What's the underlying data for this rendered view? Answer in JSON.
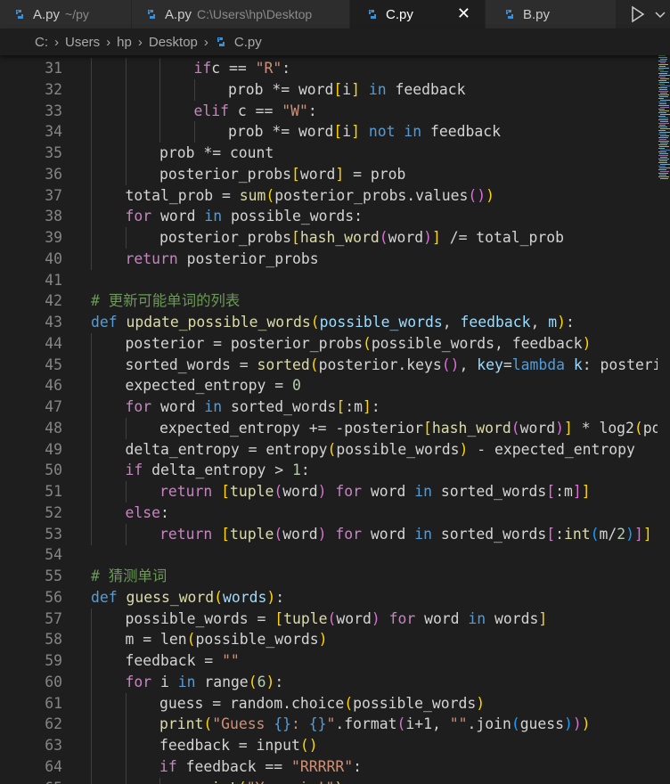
{
  "tabs": [
    {
      "name": "A.py",
      "path": "~/py",
      "active": false
    },
    {
      "name": "A.py",
      "path": "C:\\Users\\hp\\Desktop",
      "active": false
    },
    {
      "name": "C.py",
      "path": "",
      "active": true
    },
    {
      "name": "B.py",
      "path": "",
      "active": false
    }
  ],
  "breadcrumb": [
    "C:",
    "Users",
    "hp",
    "Desktop",
    "C.py"
  ],
  "colors": {
    "editor_bg": "#1e1e1e",
    "keyword": "#569cd6",
    "control": "#c586c0",
    "function": "#dcdcaa",
    "string": "#ce9178",
    "number": "#b5cea8",
    "variable": "#9cdcfe",
    "comment": "#6a9955",
    "python_icon": "#3a8fd6"
  },
  "editor": {
    "lines": [
      {
        "n": "31",
        "indent": 3,
        "tokens": [
          [
            "cf",
            "if"
          ],
          [
            "",
            "c == "
          ],
          [
            "st",
            "\"R\""
          ],
          [
            "",
            ":"
          ]
        ]
      },
      {
        "n": "32",
        "indent": 4,
        "tokens": [
          [
            "",
            "prob *= word"
          ],
          [
            "b1",
            "["
          ],
          [
            "",
            "i"
          ],
          [
            "b1",
            "]"
          ],
          [
            "",
            " "
          ],
          [
            "kw",
            "in"
          ],
          [
            "",
            " feedback"
          ]
        ]
      },
      {
        "n": "33",
        "indent": 3,
        "tokens": [
          [
            "cf",
            "elif"
          ],
          [
            "",
            " c == "
          ],
          [
            "st",
            "\"W\""
          ],
          [
            "",
            ":"
          ]
        ]
      },
      {
        "n": "34",
        "indent": 4,
        "tokens": [
          [
            "",
            "prob *= word"
          ],
          [
            "b1",
            "["
          ],
          [
            "",
            "i"
          ],
          [
            "b1",
            "]"
          ],
          [
            "",
            " "
          ],
          [
            "kw",
            "not in"
          ],
          [
            "",
            " feedback"
          ]
        ]
      },
      {
        "n": "35",
        "indent": 2,
        "tokens": [
          [
            "",
            "prob *= count"
          ]
        ]
      },
      {
        "n": "36",
        "indent": 2,
        "tokens": [
          [
            "",
            "posterior_probs"
          ],
          [
            "b1",
            "["
          ],
          [
            "",
            "word"
          ],
          [
            "b1",
            "]"
          ],
          [
            "",
            " = prob"
          ]
        ]
      },
      {
        "n": "37",
        "indent": 1,
        "tokens": [
          [
            "",
            "total_prob = "
          ],
          [
            "fn",
            "sum"
          ],
          [
            "b1",
            "("
          ],
          [
            "",
            "posterior_probs.values"
          ],
          [
            "b2",
            "()"
          ],
          [
            "b1",
            ")"
          ]
        ]
      },
      {
        "n": "38",
        "indent": 1,
        "tokens": [
          [
            "cf",
            "for"
          ],
          [
            "",
            " word "
          ],
          [
            "kw",
            "in"
          ],
          [
            "",
            " possible_words:"
          ]
        ]
      },
      {
        "n": "39",
        "indent": 2,
        "tokens": [
          [
            "",
            "posterior_probs"
          ],
          [
            "b1",
            "["
          ],
          [
            "fn",
            "hash_word"
          ],
          [
            "b2",
            "("
          ],
          [
            "",
            "word"
          ],
          [
            "b2",
            ")"
          ],
          [
            "b1",
            "]"
          ],
          [
            "",
            " /= total_prob"
          ]
        ]
      },
      {
        "n": "40",
        "indent": 1,
        "tokens": [
          [
            "cf",
            "return"
          ],
          [
            "",
            " posterior_probs"
          ]
        ]
      },
      {
        "n": "41",
        "indent": 0,
        "tokens": []
      },
      {
        "n": "42",
        "indent": 0,
        "tokens": [
          [
            "cm",
            "# 更新可能单词的列表"
          ]
        ]
      },
      {
        "n": "43",
        "indent": 0,
        "tokens": [
          [
            "kw",
            "def"
          ],
          [
            "",
            " "
          ],
          [
            "fn",
            "update_possible_words"
          ],
          [
            "b1",
            "("
          ],
          [
            "vr",
            "possible_words"
          ],
          [
            "",
            ", "
          ],
          [
            "vr",
            "feedback"
          ],
          [
            "",
            ", "
          ],
          [
            "vr",
            "m"
          ],
          [
            "b1",
            ")"
          ],
          [
            "",
            ":"
          ]
        ]
      },
      {
        "n": "44",
        "indent": 1,
        "tokens": [
          [
            "",
            "posterior = posterior_probs"
          ],
          [
            "b1",
            "("
          ],
          [
            "",
            "possible_words, feedback"
          ],
          [
            "b1",
            ")"
          ]
        ]
      },
      {
        "n": "45",
        "indent": 1,
        "tokens": [
          [
            "",
            "sorted_words = "
          ],
          [
            "fn",
            "sorted"
          ],
          [
            "b1",
            "("
          ],
          [
            "",
            "posterior.keys"
          ],
          [
            "b2",
            "()"
          ],
          [
            "",
            ", "
          ],
          [
            "vr",
            "key"
          ],
          [
            "",
            "="
          ],
          [
            "kw",
            "lambda"
          ],
          [
            "",
            " "
          ],
          [
            "vr",
            "k"
          ],
          [
            "",
            ": posterior"
          ]
        ]
      },
      {
        "n": "46",
        "indent": 1,
        "tokens": [
          [
            "",
            "expected_entropy = "
          ],
          [
            "nm",
            "0"
          ]
        ]
      },
      {
        "n": "47",
        "indent": 1,
        "tokens": [
          [
            "cf",
            "for"
          ],
          [
            "",
            " word "
          ],
          [
            "kw",
            "in"
          ],
          [
            "",
            " sorted_words"
          ],
          [
            "b1",
            "["
          ],
          [
            "",
            ":m"
          ],
          [
            "b1",
            "]"
          ],
          [
            "",
            ":"
          ]
        ]
      },
      {
        "n": "48",
        "indent": 2,
        "tokens": [
          [
            "",
            "expected_entropy += -posterior"
          ],
          [
            "b1",
            "["
          ],
          [
            "fn",
            "hash_word"
          ],
          [
            "b2",
            "("
          ],
          [
            "",
            "word"
          ],
          [
            "b2",
            ")"
          ],
          [
            "b1",
            "]"
          ],
          [
            "",
            " * log2"
          ],
          [
            "b1",
            "("
          ],
          [
            "",
            "pos"
          ]
        ]
      },
      {
        "n": "49",
        "indent": 1,
        "tokens": [
          [
            "",
            "delta_entropy = entropy"
          ],
          [
            "b1",
            "("
          ],
          [
            "",
            "possible_words"
          ],
          [
            "b1",
            ")"
          ],
          [
            "",
            " - expected_entropy"
          ]
        ]
      },
      {
        "n": "50",
        "indent": 1,
        "tokens": [
          [
            "cf",
            "if"
          ],
          [
            "",
            " delta_entropy > "
          ],
          [
            "nm",
            "1"
          ],
          [
            "",
            ":"
          ]
        ]
      },
      {
        "n": "51",
        "indent": 2,
        "tokens": [
          [
            "cf",
            "return"
          ],
          [
            "",
            " "
          ],
          [
            "b1",
            "["
          ],
          [
            "fn",
            "tuple"
          ],
          [
            "b2",
            "("
          ],
          [
            "",
            "word"
          ],
          [
            "b2",
            ")"
          ],
          [
            "",
            " "
          ],
          [
            "cf",
            "for"
          ],
          [
            "",
            " word "
          ],
          [
            "kw",
            "in"
          ],
          [
            "",
            " sorted_words"
          ],
          [
            "b2",
            "["
          ],
          [
            "",
            ":m"
          ],
          [
            "b2",
            "]"
          ],
          [
            "b1",
            "]"
          ]
        ]
      },
      {
        "n": "52",
        "indent": 1,
        "tokens": [
          [
            "cf",
            "else"
          ],
          [
            "",
            ":"
          ]
        ]
      },
      {
        "n": "53",
        "indent": 2,
        "tokens": [
          [
            "cf",
            "return"
          ],
          [
            "",
            " "
          ],
          [
            "b1",
            "["
          ],
          [
            "fn",
            "tuple"
          ],
          [
            "b2",
            "("
          ],
          [
            "",
            "word"
          ],
          [
            "b2",
            ")"
          ],
          [
            "",
            " "
          ],
          [
            "cf",
            "for"
          ],
          [
            "",
            " word "
          ],
          [
            "kw",
            "in"
          ],
          [
            "",
            " sorted_words"
          ],
          [
            "b2",
            "["
          ],
          [
            "",
            ":"
          ],
          [
            "fn",
            "int"
          ],
          [
            "b3",
            "("
          ],
          [
            "",
            "m/"
          ],
          [
            "nm",
            "2"
          ],
          [
            "b3",
            ")"
          ],
          [
            "b2",
            "]"
          ],
          [
            "b1",
            "]"
          ]
        ]
      },
      {
        "n": "54",
        "indent": 0,
        "tokens": []
      },
      {
        "n": "55",
        "indent": 0,
        "tokens": [
          [
            "cm",
            "# 猜测单词"
          ]
        ]
      },
      {
        "n": "56",
        "indent": 0,
        "tokens": [
          [
            "kw",
            "def"
          ],
          [
            "",
            " "
          ],
          [
            "fn",
            "guess_word"
          ],
          [
            "b1",
            "("
          ],
          [
            "vr",
            "words"
          ],
          [
            "b1",
            ")"
          ],
          [
            "",
            ":"
          ]
        ]
      },
      {
        "n": "57",
        "indent": 1,
        "tokens": [
          [
            "",
            "possible_words = "
          ],
          [
            "b1",
            "["
          ],
          [
            "fn",
            "tuple"
          ],
          [
            "b2",
            "("
          ],
          [
            "",
            "word"
          ],
          [
            "b2",
            ")"
          ],
          [
            "",
            " "
          ],
          [
            "cf",
            "for"
          ],
          [
            "",
            " word "
          ],
          [
            "kw",
            "in"
          ],
          [
            "",
            " words"
          ],
          [
            "b1",
            "]"
          ]
        ]
      },
      {
        "n": "58",
        "indent": 1,
        "tokens": [
          [
            "",
            "m = len"
          ],
          [
            "b1",
            "("
          ],
          [
            "",
            "possible_words"
          ],
          [
            "b1",
            ")"
          ]
        ]
      },
      {
        "n": "59",
        "indent": 1,
        "tokens": [
          [
            "",
            "feedback = "
          ],
          [
            "st",
            "\"\""
          ]
        ]
      },
      {
        "n": "60",
        "indent": 1,
        "tokens": [
          [
            "cf",
            "for"
          ],
          [
            "",
            " i "
          ],
          [
            "kw",
            "in"
          ],
          [
            "",
            " range"
          ],
          [
            "b1",
            "("
          ],
          [
            "nm",
            "6"
          ],
          [
            "b1",
            ")"
          ],
          [
            "",
            ":"
          ]
        ]
      },
      {
        "n": "61",
        "indent": 2,
        "tokens": [
          [
            "",
            "guess = random.choice"
          ],
          [
            "b1",
            "("
          ],
          [
            "",
            "possible_words"
          ],
          [
            "b1",
            ")"
          ]
        ]
      },
      {
        "n": "62",
        "indent": 2,
        "tokens": [
          [
            "fn",
            "print"
          ],
          [
            "b1",
            "("
          ],
          [
            "st",
            "\"Guess "
          ],
          [
            "kw",
            "{}"
          ],
          [
            "st",
            ": "
          ],
          [
            "kw",
            "{}"
          ],
          [
            "st",
            "\""
          ],
          [
            "",
            ".format"
          ],
          [
            "b2",
            "("
          ],
          [
            "",
            "i+1, "
          ],
          [
            "st",
            "\"\""
          ],
          [
            "",
            ".join"
          ],
          [
            "b3",
            "("
          ],
          [
            "",
            "guess"
          ],
          [
            "b3",
            ")"
          ],
          [
            "b2",
            ")"
          ],
          [
            "b1",
            ")"
          ]
        ]
      },
      {
        "n": "63",
        "indent": 2,
        "tokens": [
          [
            "",
            "feedback = input"
          ],
          [
            "b1",
            "()"
          ]
        ]
      },
      {
        "n": "64",
        "indent": 2,
        "tokens": [
          [
            "cf",
            "if"
          ],
          [
            "",
            " feedback == "
          ],
          [
            "st",
            "\"RRRRR\""
          ],
          [
            "",
            ":"
          ]
        ]
      },
      {
        "n": "65",
        "indent": 3,
        "tokens": [
          [
            "fn",
            "print"
          ],
          [
            "b1",
            "("
          ],
          [
            "st",
            "\"You win!\""
          ],
          [
            "b1",
            ")"
          ]
        ]
      }
    ]
  }
}
